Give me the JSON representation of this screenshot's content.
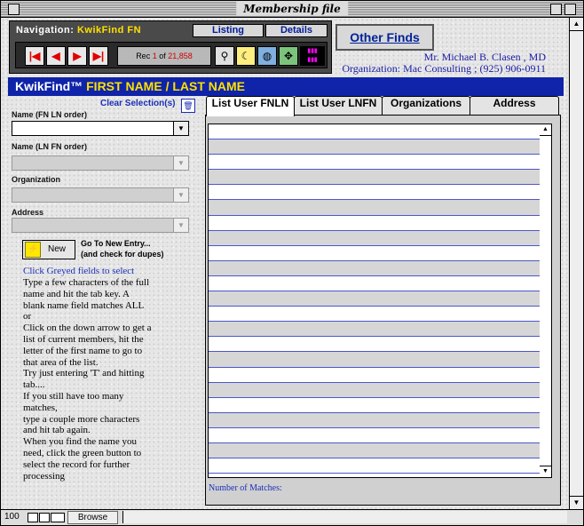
{
  "window": {
    "title": "Membership file"
  },
  "navigation": {
    "label_prefix": "Navigation:",
    "label_find": "KwikFind FN",
    "listing_tab": "Listing",
    "details_tab": "Details",
    "record": {
      "prefix": "Rec",
      "current": "1",
      "of": "of",
      "total": "21,858"
    },
    "buttons": [
      "first-record",
      "previous-record",
      "next-record",
      "last-record"
    ],
    "tools": [
      "find-magnifier-icon",
      "sort-icon",
      "globe-icon",
      "navigator-icon",
      "spectrum-icon"
    ]
  },
  "other_finds_label": "Other Finds",
  "user": {
    "name": "Mr. Michael B. Clasen , MD",
    "org": "Organization: Mac Consulting ; (925) 906-0911"
  },
  "header": {
    "prefix": "KwikFind™",
    "title": "FIRST NAME / LAST NAME"
  },
  "form": {
    "clear_label": "Clear Selection(s)",
    "fields": [
      {
        "label": "Name (FN LN order)",
        "value": ""
      },
      {
        "label": "Name (LN FN order)",
        "value": ""
      },
      {
        "label": "Organization",
        "value": ""
      },
      {
        "label": "Address",
        "value": ""
      }
    ],
    "new_button": "New",
    "new_hint_1": "Go To New Entry...",
    "new_hint_2": "(and check for dupes)",
    "help_title": "Click Greyed fields to select",
    "help_text": "Type a few characters of the full\nname and hit the tab key.  A\nblank name field matches ALL\nor\nClick on the down arrow to get a\nlist of current members, hit the\nletter of the first name to go to\nthat area of the list.\nTry just entering 'T' and hitting\ntab....\nIf you still have too many\nmatches,\ntype a couple more characters\nand hit tab again.\nWhen you find the name you\nneed, click the green button to\nselect the record for further\nprocessing"
  },
  "tabs": [
    "List User FNLN",
    "List User LNFN",
    "Organizations",
    "Address"
  ],
  "matches_label": "Number of Matches:",
  "status": {
    "zoom": "100",
    "mode": "Browse"
  }
}
